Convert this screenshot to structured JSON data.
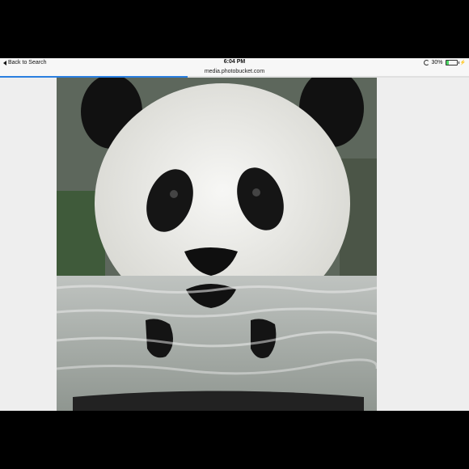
{
  "status_bar": {
    "back_label": "Back to Search",
    "time": "6:04 PM",
    "battery_percent": "30%",
    "battery_level": 0.3
  },
  "url_bar": {
    "url": "media.photobucket.com",
    "load_progress": 0.4
  },
  "content": {
    "image_subject": "panda-photo"
  },
  "colors": {
    "progress": "#2a7fe0",
    "battery": "#4cd964",
    "chrome": "#f7f7f7"
  }
}
